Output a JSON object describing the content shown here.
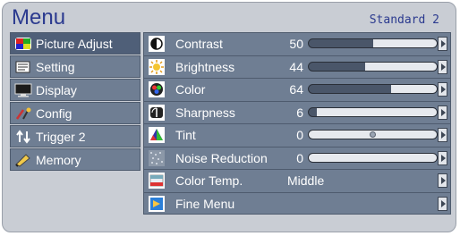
{
  "header": {
    "title": "Menu",
    "mode": "Standard 2"
  },
  "sidebar": {
    "items": [
      {
        "label": "Picture Adjust",
        "icon": "picture-adjust-icon",
        "active": true
      },
      {
        "label": "Setting",
        "icon": "setting-icon"
      },
      {
        "label": "Display",
        "icon": "display-icon"
      },
      {
        "label": "Config",
        "icon": "config-icon"
      },
      {
        "label": "Trigger 2",
        "icon": "trigger-icon"
      },
      {
        "label": "Memory",
        "icon": "memory-icon"
      }
    ]
  },
  "rows": [
    {
      "label": "Contrast",
      "value": "50",
      "level": 0.5,
      "type": "slider",
      "icon": "contrast-icon"
    },
    {
      "label": "Brightness",
      "value": "44",
      "level": 0.44,
      "type": "slider",
      "icon": "brightness-icon"
    },
    {
      "label": "Color",
      "value": "64",
      "level": 0.64,
      "type": "slider",
      "icon": "color-icon"
    },
    {
      "label": "Sharpness",
      "value": "6",
      "level": 0.06,
      "type": "slider",
      "icon": "sharpness-icon"
    },
    {
      "label": "Tint",
      "value": "0",
      "level": 0.5,
      "type": "center-slider",
      "icon": "tint-icon"
    },
    {
      "label": "Noise Reduction",
      "value": "0",
      "level": 0.0,
      "type": "slider",
      "icon": "noise-reduction-icon"
    },
    {
      "label": "Color Temp.",
      "value": "Middle",
      "type": "text",
      "icon": "color-temp-icon"
    },
    {
      "label": "Fine Menu",
      "value": "",
      "type": "menu",
      "icon": "fine-menu-icon"
    }
  ],
  "colors": {
    "accent": "#2b3a8f",
    "panel": "#6f7e93",
    "fill": "#e6e9ee"
  }
}
